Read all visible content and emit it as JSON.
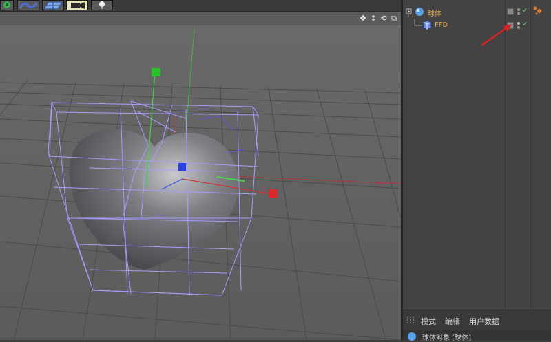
{
  "toolbar": {
    "buttons": [
      {
        "name": "deformer-tool",
        "icon": "leaf-icon",
        "color": "#38b24c"
      },
      {
        "name": "spline-tool",
        "icon": "wave-icon",
        "color": "#4a6fd6"
      },
      {
        "name": "floor-tool",
        "icon": "grid-floor-icon",
        "color": "#5a8ad0"
      },
      {
        "name": "camera-tool",
        "icon": "camera-icon",
        "color": "#2a2a2a"
      },
      {
        "name": "light-tool",
        "icon": "light-bulb-icon",
        "color": "#eeeeee"
      }
    ]
  },
  "viewport": {
    "nav": [
      "✥",
      "↕",
      "⟲",
      "⧉"
    ]
  },
  "object_manager": {
    "objects": [
      {
        "name": "球体",
        "icon": "sphere-icon",
        "color": "#e0a64c",
        "selected": true
      },
      {
        "name": "FFD",
        "icon": "ffd-icon",
        "color": "#d9a24a",
        "selected": false
      }
    ]
  },
  "attributes": {
    "tabs": [
      "模式",
      "编辑",
      "用户数据"
    ],
    "footer_title": "球体对象 [球体]"
  },
  "colors": {
    "accent": "#e0a64c",
    "check": "#62d36b",
    "arrow": "#e02020",
    "lattice": "#9b8cff"
  }
}
